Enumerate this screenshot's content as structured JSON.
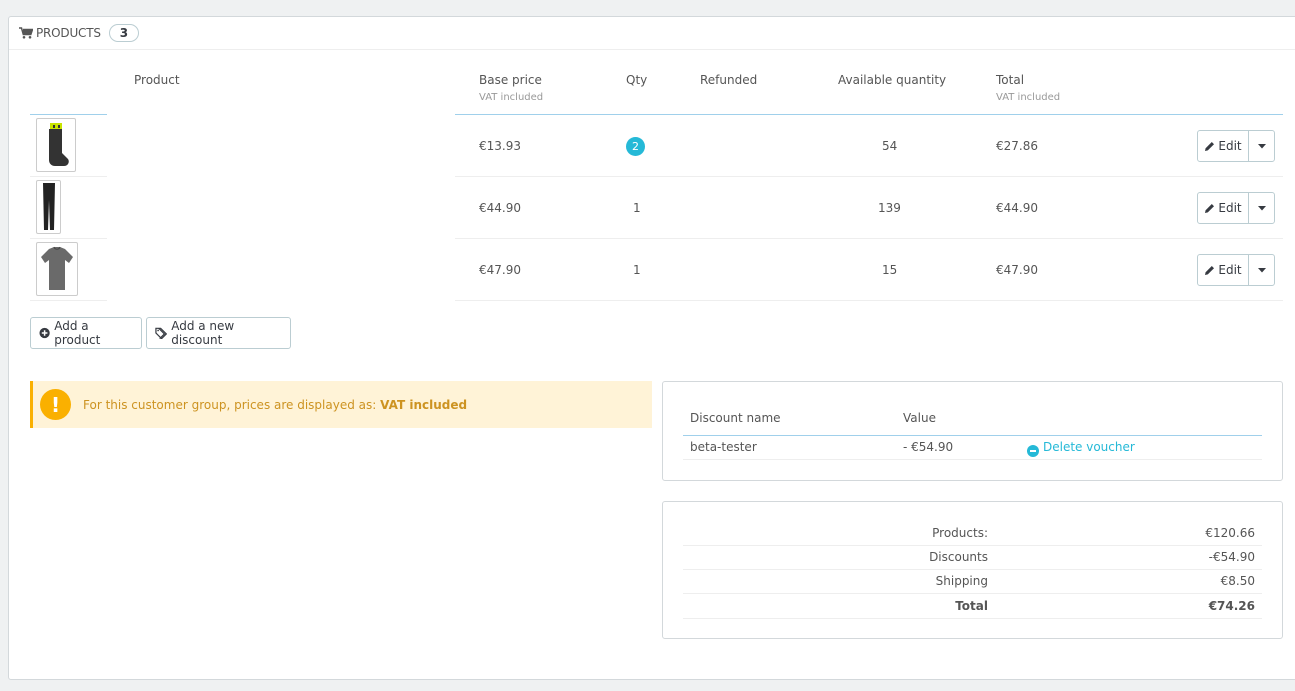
{
  "panel": {
    "title": "Products",
    "count": "3",
    "icon": "shopping-cart-icon"
  },
  "table": {
    "headers": {
      "product": "Product",
      "base_price": "Base price",
      "base_price_sub": "VAT included",
      "qty": "Qty",
      "refunded": "Refunded",
      "available": "Available quantity",
      "total": "Total",
      "total_sub": "VAT included"
    },
    "rows": [
      {
        "thumbnail": "socks-image",
        "base_price": "€13.93",
        "qty": "2",
        "refunded": "",
        "available": "54",
        "total": "€27.86",
        "edit": "Edit"
      },
      {
        "thumbnail": "tights-image",
        "base_price": "€44.90",
        "qty": "1",
        "refunded": "",
        "available": "139",
        "total": "€44.90",
        "edit": "Edit"
      },
      {
        "thumbnail": "tshirt-image",
        "base_price": "€47.90",
        "qty": "1",
        "refunded": "",
        "available": "15",
        "total": "€47.90",
        "edit": "Edit"
      }
    ]
  },
  "actions": {
    "add_product": "Add a product",
    "add_discount": "Add a new discount"
  },
  "alert": {
    "text": "For this customer group, prices are displayed as:",
    "emphasis": "VAT included",
    "color": "#fab000"
  },
  "discounts": {
    "headers": {
      "name": "Discount name",
      "value": "Value"
    },
    "rows": [
      {
        "name": "beta-tester",
        "value": "- €54.90",
        "action": "Delete voucher"
      }
    ]
  },
  "summary": {
    "products_label": "Products:",
    "products_value": "€120.66",
    "discounts_label": "Discounts",
    "discounts_value": "-€54.90",
    "shipping_label": "Shipping",
    "shipping_value": "€8.50",
    "total_label": "Total",
    "total_value": "€74.26"
  },
  "colors": {
    "accent": "#25b9d7",
    "warning": "#fab000"
  }
}
